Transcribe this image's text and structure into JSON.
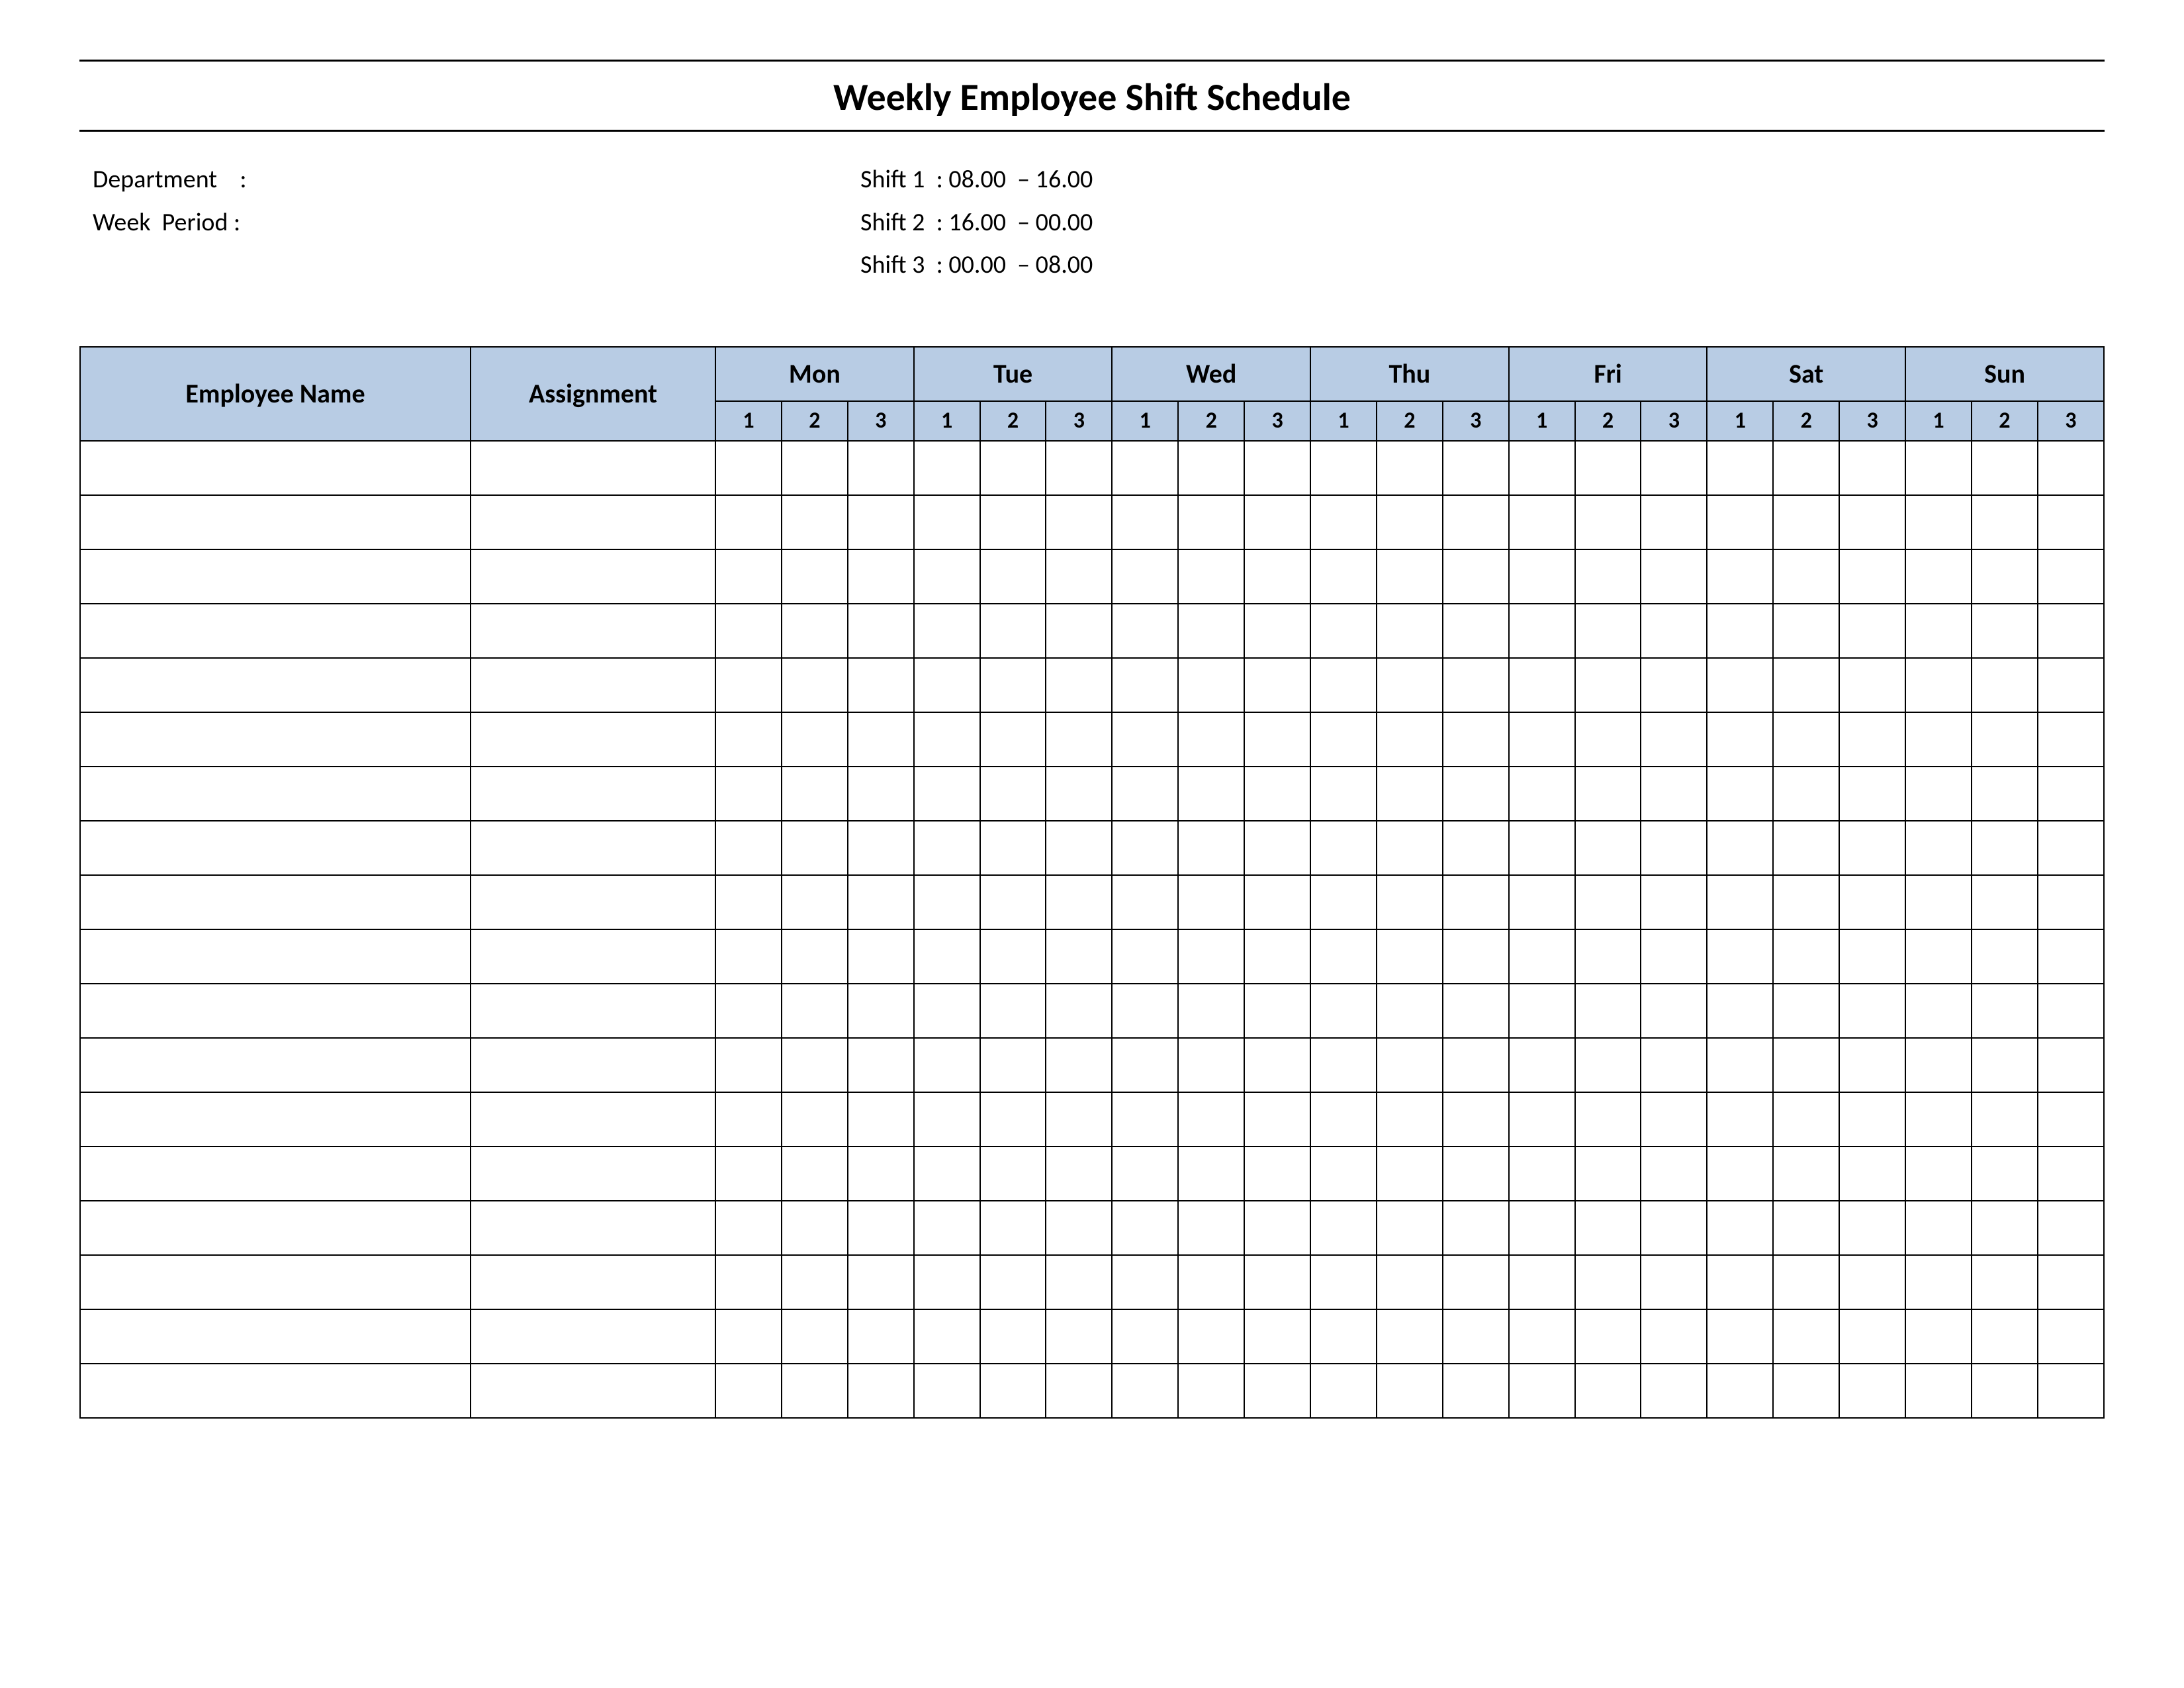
{
  "title": "Weekly Employee Shift Schedule",
  "meta": {
    "left": [
      {
        "label": "Department",
        "sep": "    :",
        "value": ""
      },
      {
        "label": "Week  Period",
        "sep": " :",
        "value": ""
      }
    ],
    "right": [
      {
        "label": "Shift 1",
        "sep": "  :",
        "value": " 08.00  – 16.00"
      },
      {
        "label": "Shift 2",
        "sep": "  :",
        "value": " 16.00  – 00.00"
      },
      {
        "label": "Shift 3",
        "sep": "  :",
        "value": " 00.00  – 08.00"
      }
    ]
  },
  "columns": {
    "employee": "Employee Name",
    "assignment": "Assignment",
    "days": [
      "Mon",
      "Tue",
      "Wed",
      "Thu",
      "Fri",
      "Sat",
      "Sun"
    ],
    "shifts": [
      "1",
      "2",
      "3"
    ]
  },
  "rows": 18
}
